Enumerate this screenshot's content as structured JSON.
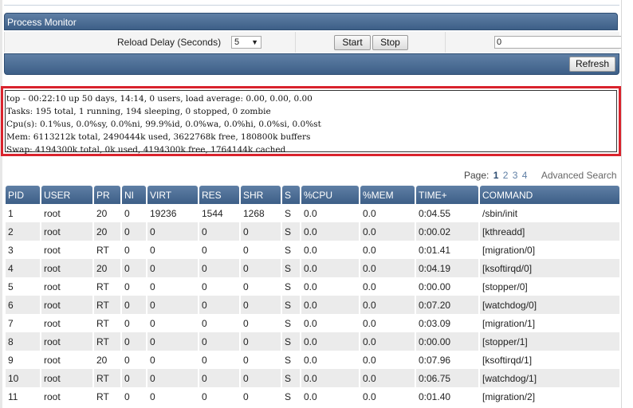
{
  "panel": {
    "title": "Process Monitor"
  },
  "controls": {
    "reload_label": "Reload Delay (Seconds)",
    "reload_value": "5",
    "start_label": "Start",
    "stop_label": "Stop",
    "filter_value": "0",
    "refresh_label": "Refresh"
  },
  "top_output": {
    "line1": "top - 00:22:10 up 50 days, 14:14, 0 users, load average: 0.00, 0.00, 0.00",
    "line2": "Tasks: 195 total, 1 running, 194 sleeping, 0 stopped, 0 zombie",
    "line3": "Cpu(s): 0.1%us, 0.0%sy, 0.0%ni, 99.9%id, 0.0%wa, 0.0%hi, 0.0%si, 0.0%st",
    "line4": "Mem: 6113212k total, 2490444k used, 3622768k free, 180800k buffers",
    "line5": "Swap: 4194300k total, 0k used, 4194300k free, 1764144k cached"
  },
  "pagination": {
    "label": "Page:",
    "pages": [
      "1",
      "2",
      "3",
      "4"
    ],
    "advanced_search": "Advanced Search"
  },
  "table": {
    "columns": [
      "PID",
      "USER",
      "PR",
      "NI",
      "VIRT",
      "RES",
      "SHR",
      "S",
      "%CPU",
      "%MEM",
      "TIME+",
      "COMMAND"
    ],
    "rows": [
      [
        "1",
        "root",
        "20",
        "0",
        "19236",
        "1544",
        "1268",
        "S",
        "0.0",
        "0.0",
        "0:04.55",
        "/sbin/init"
      ],
      [
        "2",
        "root",
        "20",
        "0",
        "0",
        "0",
        "0",
        "S",
        "0.0",
        "0.0",
        "0:00.02",
        "[kthreadd]"
      ],
      [
        "3",
        "root",
        "RT",
        "0",
        "0",
        "0",
        "0",
        "S",
        "0.0",
        "0.0",
        "0:01.41",
        "[migration/0]"
      ],
      [
        "4",
        "root",
        "20",
        "0",
        "0",
        "0",
        "0",
        "S",
        "0.0",
        "0.0",
        "0:04.19",
        "[ksoftirqd/0]"
      ],
      [
        "5",
        "root",
        "RT",
        "0",
        "0",
        "0",
        "0",
        "S",
        "0.0",
        "0.0",
        "0:00.00",
        "[stopper/0]"
      ],
      [
        "6",
        "root",
        "RT",
        "0",
        "0",
        "0",
        "0",
        "S",
        "0.0",
        "0.0",
        "0:07.20",
        "[watchdog/0]"
      ],
      [
        "7",
        "root",
        "RT",
        "0",
        "0",
        "0",
        "0",
        "S",
        "0.0",
        "0.0",
        "0:03.09",
        "[migration/1]"
      ],
      [
        "8",
        "root",
        "RT",
        "0",
        "0",
        "0",
        "0",
        "S",
        "0.0",
        "0.0",
        "0:00.00",
        "[stopper/1]"
      ],
      [
        "9",
        "root",
        "20",
        "0",
        "0",
        "0",
        "0",
        "S",
        "0.0",
        "0.0",
        "0:07.96",
        "[ksoftirqd/1]"
      ],
      [
        "10",
        "root",
        "RT",
        "0",
        "0",
        "0",
        "0",
        "S",
        "0.0",
        "0.0",
        "0:06.75",
        "[watchdog/1]"
      ],
      [
        "11",
        "root",
        "RT",
        "0",
        "0",
        "0",
        "0",
        "S",
        "0.0",
        "0.0",
        "0:01.40",
        "[migration/2]"
      ]
    ]
  }
}
